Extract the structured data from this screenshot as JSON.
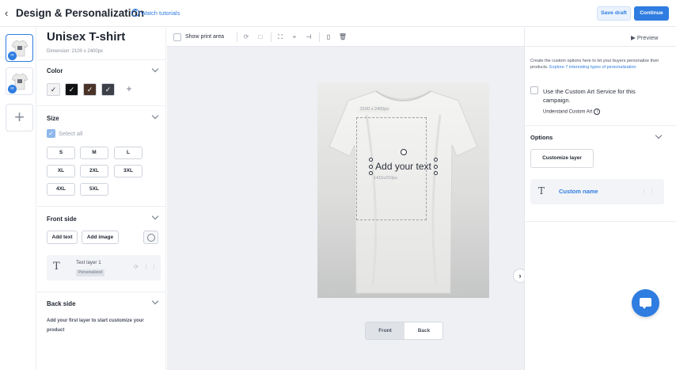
{
  "header": {
    "back_icon": "chevron-left-icon",
    "title": "Design & Personalization",
    "help_icon": "question-circle-icon",
    "tutorials_link": "Watch tutorials",
    "save_draft": "Save draft",
    "continue": "Continue",
    "accent_color": "#2f7de1"
  },
  "rail": {
    "add_label": "+"
  },
  "product": {
    "name": "Unisex T-shirt",
    "dimension": "Dimension: 2100 x 2400px"
  },
  "color_section": {
    "title": "Color",
    "swatches": [
      {
        "color": "#f3f3f3",
        "checked": true
      },
      {
        "color": "#111111",
        "checked": true
      },
      {
        "color": "#4a3328",
        "checked": true
      },
      {
        "color": "#3d4047",
        "checked": true
      }
    ],
    "add_label": "+"
  },
  "size_section": {
    "title": "Size",
    "select_all": "Select all",
    "sizes": [
      "S",
      "M",
      "L",
      "XL",
      "2XL",
      "3XL",
      "4XL",
      "5XL"
    ]
  },
  "front_side": {
    "title": "Front side",
    "add_text": "Add text",
    "add_image": "Add image",
    "layer": {
      "name": "Text layer 1",
      "badge": "Personalized"
    }
  },
  "back_side": {
    "title": "Back side",
    "empty_text": "Add your first layer to start customize your product"
  },
  "toolbar": {
    "show_print_area": "Show print area"
  },
  "canvas": {
    "print_area_dim": "2100 x 2400px",
    "placeholder_text": "Add your text",
    "text_dim": "1415x210px"
  },
  "side_toggle": {
    "front": "Front",
    "back": "Back",
    "active": "Front"
  },
  "right_panel": {
    "preview": "▶ Preview",
    "intro": "Create the custom options here to let your buyers personalize their products.",
    "intro_link": "Explore 7 interesting types of personalization",
    "custom_art_label": "Use the Custom Art Service for this campaign.",
    "custom_art_sub": "Understand Custom Art",
    "options_title": "Options",
    "customize_layer": "Customize layer",
    "option_name": "Custom name"
  }
}
